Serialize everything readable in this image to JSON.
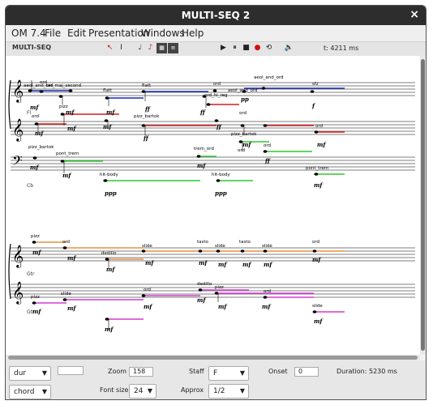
{
  "window": {
    "title": "MULTI-SEQ 2",
    "close_glyph": "×"
  },
  "menu": [
    "OM 7.4",
    "File",
    "Edit",
    "Presentation",
    "Windows",
    "Help"
  ],
  "toolbar": {
    "name": "MULTI-SEQ",
    "tools": [
      "arrow-tool-icon",
      "text-cursor-icon",
      "note-icon",
      "red-note-icon",
      "chord-icon",
      "staff-icon"
    ],
    "transport": [
      "play-icon",
      "pause-icon",
      "stop-icon",
      "record-icon",
      "loop-icon",
      "speaker-icon"
    ],
    "time": "t: 4211 ms"
  },
  "score": {
    "instruments": [
      "Fl",
      "Cb",
      "Gtr",
      "Gtr"
    ],
    "annotations": [
      "aeol_and_ord",
      "ord",
      "aeol_and_ord",
      "tar_maj_second",
      "flatt",
      "flatt",
      "ord",
      "ord_hi_reg",
      "aeol_and_ord",
      "sfz",
      "ord",
      "pizz",
      "pizz_bartok",
      "pizz_bartok",
      "ord",
      "ord",
      "pizz_bartok",
      "pont_trem",
      "trem_ord",
      "ord",
      "ord",
      "hit-body",
      "hit-body",
      "pont_trem",
      "pizz",
      "ord",
      "dedillo",
      "slide",
      "tasto",
      "slide",
      "tasto",
      "slide",
      "ord",
      "pizz",
      "slide",
      "ord",
      "dedillo",
      "pizz",
      "ord",
      "slide"
    ],
    "dynamics": [
      "mf",
      "ff",
      "pp",
      "ppp",
      "f"
    ]
  },
  "panel": {
    "dur": "dur",
    "chord": "chord",
    "zoom_label": "Zoom",
    "zoom_value": "158",
    "font_label": "Font size",
    "font_value": "24",
    "staff_label": "Staff",
    "staff_value": "F",
    "approx_label": "Approx",
    "approx_value": "1/2",
    "onset_label": "Onset",
    "onset_value": "0",
    "duration": "Duration: 5230 ms",
    "color_swatch": "#ffffff"
  },
  "colors": {
    "blue": "#1a28b4",
    "red": "#d21e1e",
    "green": "#2ec82e",
    "orange": "#e89040",
    "magenta": "#d23cd2",
    "titlebar": "#2d2d2d"
  }
}
